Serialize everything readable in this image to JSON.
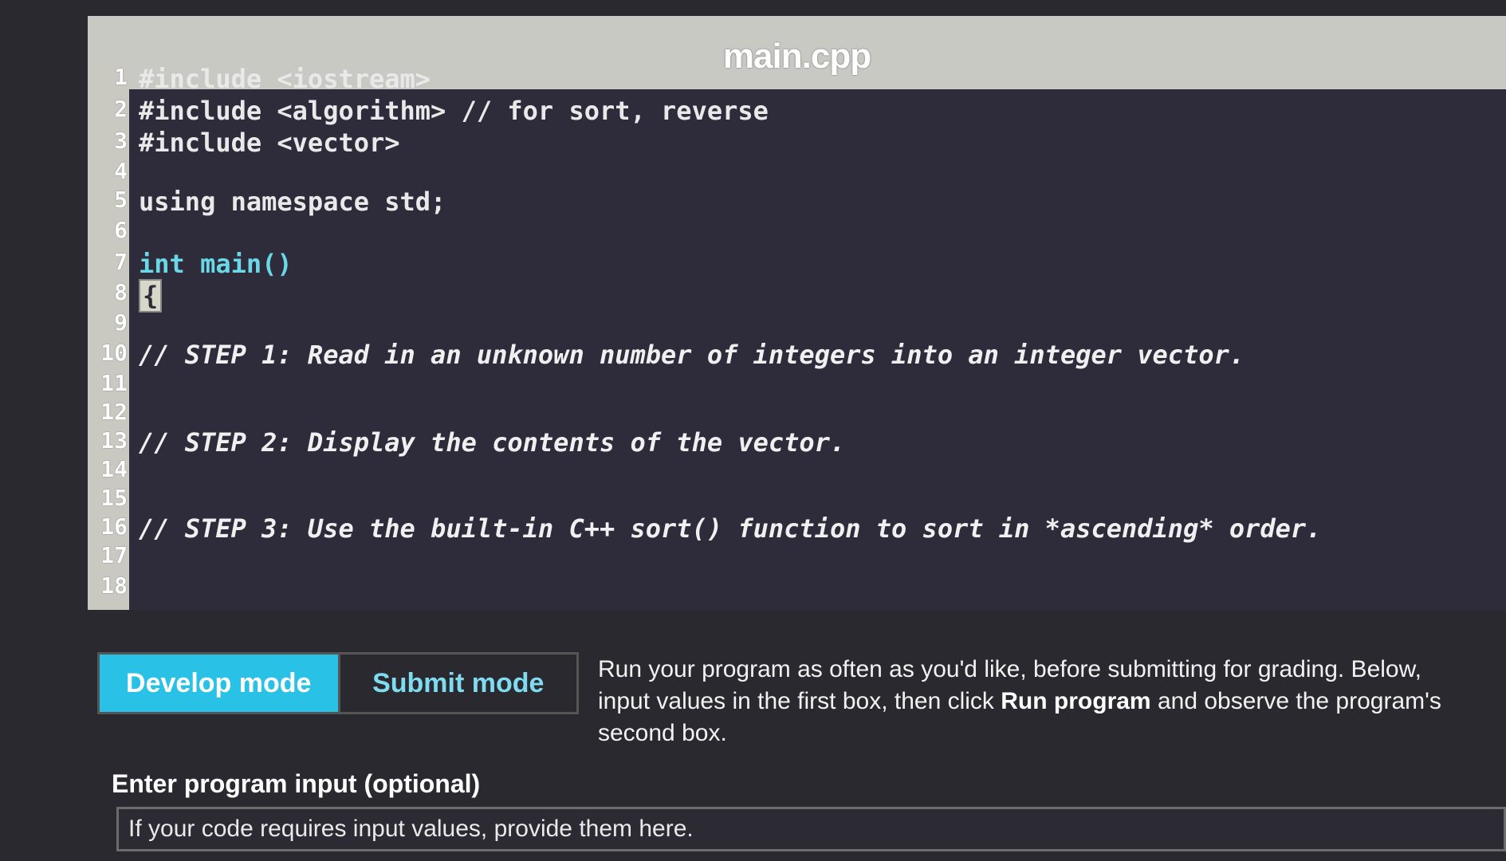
{
  "editor": {
    "filename": "main.cpp",
    "lines": [
      {
        "num": "1",
        "text": "#include <iostream>"
      },
      {
        "num": "2",
        "text": "#include <algorithm> // for sort, reverse"
      },
      {
        "num": "3",
        "text": "#include <vector>"
      },
      {
        "num": "4",
        "text": ""
      },
      {
        "num": "5",
        "text": "using namespace std;"
      },
      {
        "num": "6",
        "text": ""
      },
      {
        "num": "7",
        "text": "int main()"
      },
      {
        "num": "8",
        "text": "{"
      },
      {
        "num": "9",
        "text": ""
      },
      {
        "num": "10",
        "text": "// STEP 1: Read in an unknown number of integers into an integer vector."
      },
      {
        "num": "11",
        "text": ""
      },
      {
        "num": "12",
        "text": ""
      },
      {
        "num": "13",
        "text": "// STEP 2: Display the contents of the vector."
      },
      {
        "num": "14",
        "text": ""
      },
      {
        "num": "15",
        "text": ""
      },
      {
        "num": "16",
        "text": "// STEP 3: Use the built-in C++ sort() function to sort in *ascending* order."
      },
      {
        "num": "17",
        "text": ""
      },
      {
        "num": "18",
        "text": ""
      }
    ]
  },
  "modes": {
    "develop_label": "Develop mode",
    "submit_label": "Submit mode"
  },
  "help": {
    "line1": "Run your program as often as you'd like, before submitting for grading. Below,",
    "line2_pre": "input values in the first box, then click ",
    "line2_bold": "Run program",
    "line2_post": " and observe the program's",
    "line3": "second box."
  },
  "program_input": {
    "label": "Enter program input (optional)",
    "placeholder": "If your code requires input values, provide them here."
  }
}
